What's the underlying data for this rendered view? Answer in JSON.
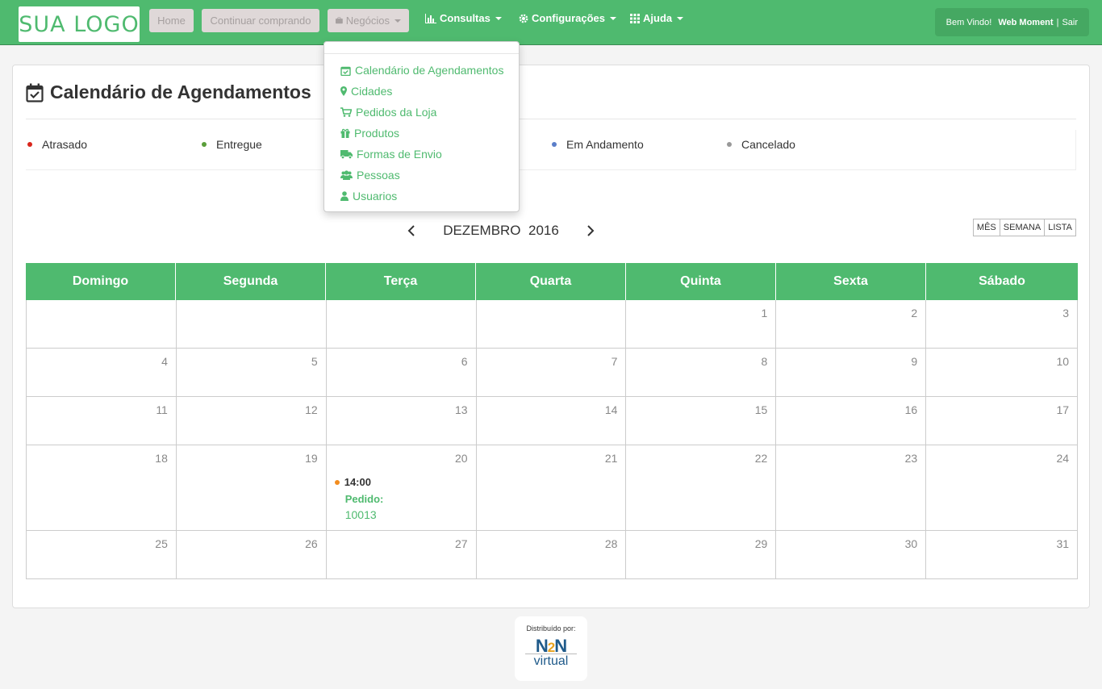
{
  "navbar": {
    "logo": "SUA LOGO",
    "home": "Home",
    "continue": "Continuar comprando",
    "negocios": "Negócios",
    "consultas": "Consultas",
    "configuracoes": "Configurações",
    "ajuda": "Ajuda",
    "welcome": "Bem Vindo!",
    "user": "Web Moment",
    "separator": "|",
    "logout": "Sair"
  },
  "page": {
    "title": "Calendário de Agendamentos"
  },
  "legend": [
    {
      "label": "Atrasado",
      "color": "#d9261c"
    },
    {
      "label": "Entregue",
      "color": "#5a9e3a"
    },
    {
      "label": "Em Andamento",
      "color": "#5b7ec9"
    },
    {
      "label": "Cancelado",
      "color": "#999999"
    }
  ],
  "calendar": {
    "month": "DEZEMBRO",
    "year": "2016",
    "views": [
      "MÊS",
      "SEMANA",
      "LISTA"
    ],
    "weekdays": [
      "Domingo",
      "Segunda",
      "Terça",
      "Quarta",
      "Quinta",
      "Sexta",
      "Sábado"
    ],
    "weeks": [
      [
        "",
        "",
        "",
        "",
        "1",
        "2",
        "3"
      ],
      [
        "4",
        "5",
        "6",
        "7",
        "8",
        "9",
        "10"
      ],
      [
        "11",
        "12",
        "13",
        "14",
        "15",
        "16",
        "17"
      ],
      [
        "18",
        "19",
        "20",
        "21",
        "22",
        "23",
        "24"
      ],
      [
        "25",
        "26",
        "27",
        "28",
        "29",
        "30",
        "31"
      ]
    ],
    "event": {
      "time": "14:00",
      "label": "Pedido:",
      "number": "10013",
      "color": "#f28c1e"
    }
  },
  "dropdown": {
    "items": [
      "Calendário de Agendamentos",
      "Cidades",
      "Pedidos da Loja",
      "Produtos",
      "Formas de Envio",
      "Pessoas",
      "Usuarios"
    ]
  },
  "footer": {
    "distributed": "Distribuído por:",
    "brand_n1": "N",
    "brand_2": "2",
    "brand_n2": "N",
    "brand_sub": "virtual"
  }
}
